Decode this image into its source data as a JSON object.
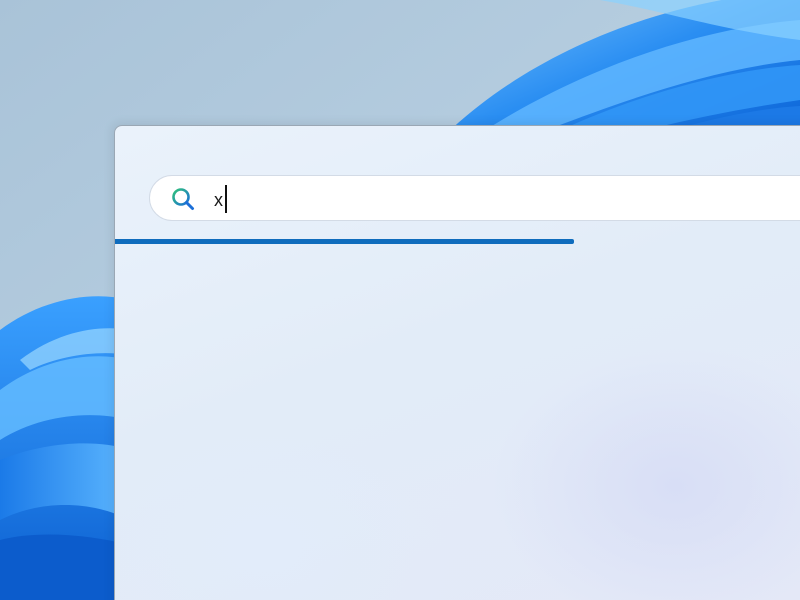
{
  "search": {
    "query": "x",
    "progress_fraction": 0.6557
  },
  "icons": {
    "search": "search-icon"
  },
  "colors": {
    "progress": "#0f6cbd",
    "wallpaper_base": "#b4cde0",
    "wallpaper_accent": "#2e8cf0"
  }
}
